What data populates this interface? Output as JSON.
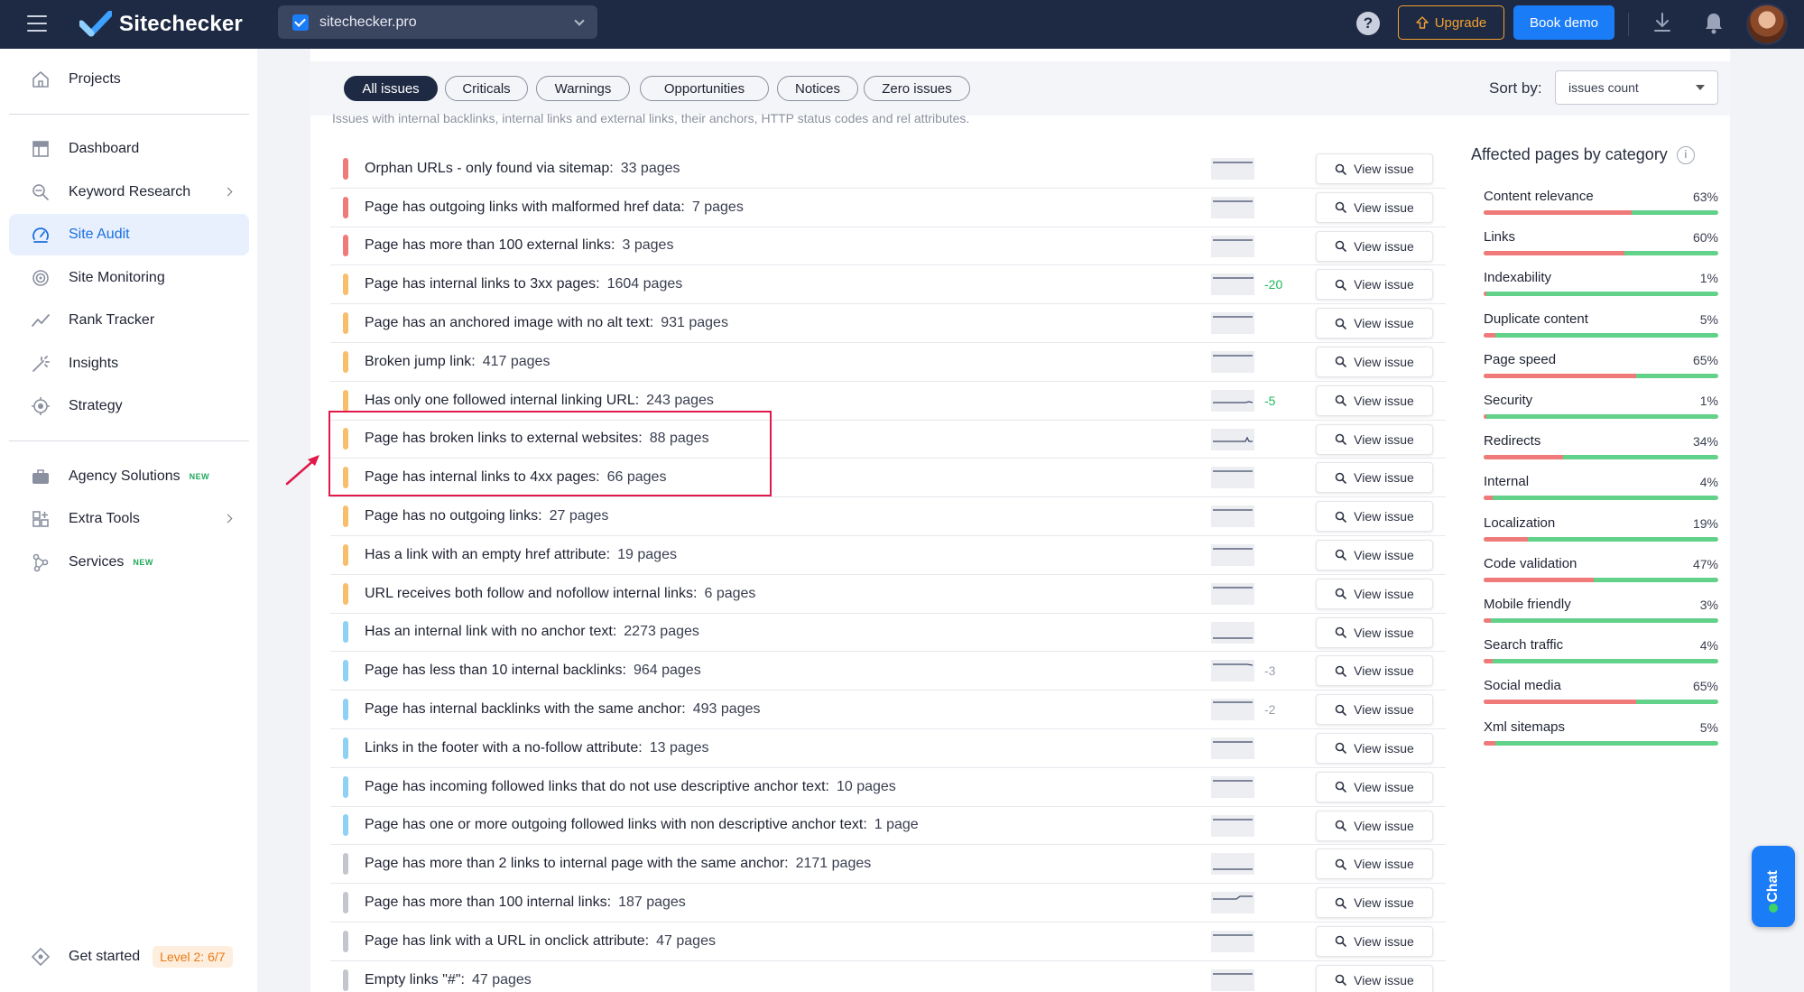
{
  "app": {
    "brand": "Sitechecker",
    "site": "sitechecker.pro",
    "help": "?",
    "upgrade_label": "Upgrade",
    "demo_label": "Book demo"
  },
  "sidebar": {
    "items": [
      {
        "label": "Projects",
        "icon": "home-icon"
      },
      {
        "label": "Dashboard",
        "icon": "dashboard-icon"
      },
      {
        "label": "Keyword Research",
        "icon": "keyword-icon"
      },
      {
        "label": "Site Audit",
        "icon": "audit-icon"
      },
      {
        "label": "Site Monitoring",
        "icon": "monitoring-icon"
      },
      {
        "label": "Rank Tracker",
        "icon": "rank-icon"
      },
      {
        "label": "Insights",
        "icon": "insights-icon"
      },
      {
        "label": "Strategy",
        "icon": "strategy-icon"
      },
      {
        "label": "Agency Solutions",
        "icon": "briefcase-icon",
        "badge": "NEW"
      },
      {
        "label": "Extra Tools",
        "icon": "tools-icon"
      },
      {
        "label": "Services",
        "icon": "services-icon",
        "badge": "NEW"
      }
    ],
    "get_started": {
      "label": "Get started",
      "level": "Level 2: 6/7"
    }
  },
  "filters": {
    "tabs": [
      "All issues",
      "Criticals",
      "Warnings",
      "Opportunities",
      "Notices",
      "Zero issues"
    ],
    "active": "All issues",
    "sort_label": "Sort by:",
    "sort_value": "issues count"
  },
  "description_cut": "Issues with internal backlinks, internal links and external links, their anchors, HTTP status codes and rel attributes.",
  "issues": [
    {
      "title": "Orphan URLs - only found via sitemap:",
      "count": "33 pages",
      "severity": "critical",
      "delta": "",
      "view": "View issue"
    },
    {
      "title": "Page has outgoing links with malformed href data:",
      "count": "7 pages",
      "severity": "critical",
      "delta": "",
      "view": "View issue"
    },
    {
      "title": "Page has more than 100 external links:",
      "count": "3 pages",
      "severity": "critical",
      "delta": "",
      "view": "View issue"
    },
    {
      "title": "Page has internal links to 3xx pages:",
      "count": "1604 pages",
      "severity": "warning",
      "delta": "-20",
      "view": "View issue"
    },
    {
      "title": "Page has an anchored image with no alt text:",
      "count": "931 pages",
      "severity": "warning",
      "delta": "",
      "view": "View issue"
    },
    {
      "title": "Broken jump link:",
      "count": "417 pages",
      "severity": "warning",
      "delta": "",
      "view": "View issue"
    },
    {
      "title": "Has only one followed internal linking URL:",
      "count": "243 pages",
      "severity": "warning",
      "delta": "-5",
      "view": "View issue"
    },
    {
      "title": "Page has broken links to external websites:",
      "count": "88 pages",
      "severity": "warning",
      "delta": "",
      "view": "View issue"
    },
    {
      "title": "Page has internal links to 4xx pages:",
      "count": "66 pages",
      "severity": "warning",
      "delta": "",
      "view": "View issue"
    },
    {
      "title": "Page has no outgoing links:",
      "count": "27 pages",
      "severity": "warning",
      "delta": "",
      "view": "View issue"
    },
    {
      "title": "Has a link with an empty href attribute:",
      "count": "19 pages",
      "severity": "warning",
      "delta": "",
      "view": "View issue"
    },
    {
      "title": "URL receives both follow and nofollow internal links:",
      "count": "6 pages",
      "severity": "warning",
      "delta": "",
      "view": "View issue"
    },
    {
      "title": "Has an internal link with no anchor text:",
      "count": "2273 pages",
      "severity": "opportunity",
      "delta": "",
      "view": "View issue"
    },
    {
      "title": "Page has less than 10 internal backlinks:",
      "count": "964 pages",
      "severity": "opportunity",
      "delta": "-3",
      "view": "View issue"
    },
    {
      "title": "Page has internal backlinks with the same anchor:",
      "count": "493 pages",
      "severity": "opportunity",
      "delta": "-2",
      "view": "View issue"
    },
    {
      "title": "Links in the footer with a no-follow attribute:",
      "count": "13 pages",
      "severity": "opportunity",
      "delta": "",
      "view": "View issue"
    },
    {
      "title": "Page has incoming followed links that do not use descriptive anchor text:",
      "count": "10 pages",
      "severity": "opportunity",
      "delta": "",
      "view": "View issue"
    },
    {
      "title": "Page has one or more outgoing followed links with non descriptive anchor text:",
      "count": "1 page",
      "severity": "opportunity",
      "delta": "",
      "view": "View issue"
    },
    {
      "title": "Page has more than 2 links to internal page with the same anchor:",
      "count": "2171 pages",
      "severity": "notice",
      "delta": "",
      "view": "View issue"
    },
    {
      "title": "Page has more than 100 internal links:",
      "count": "187 pages",
      "severity": "notice",
      "delta": "",
      "view": "View issue"
    },
    {
      "title": "Page has link with a URL in onclick attribute:",
      "count": "47 pages",
      "severity": "notice",
      "delta": "",
      "view": "View issue"
    },
    {
      "title": "Empty links \"#\":",
      "count": "47 pages",
      "severity": "notice",
      "delta": "",
      "view": "View issue"
    }
  ],
  "categories": {
    "title": "Affected pages by category",
    "items": [
      {
        "name": "Content relevance",
        "pct": "63%",
        "value": 63
      },
      {
        "name": "Links",
        "pct": "60%",
        "value": 60
      },
      {
        "name": "Indexability",
        "pct": "1%",
        "value": 1
      },
      {
        "name": "Duplicate content",
        "pct": "5%",
        "value": 5
      },
      {
        "name": "Page speed",
        "pct": "65%",
        "value": 65
      },
      {
        "name": "Security",
        "pct": "1%",
        "value": 1
      },
      {
        "name": "Redirects",
        "pct": "34%",
        "value": 34
      },
      {
        "name": "Internal",
        "pct": "4%",
        "value": 4
      },
      {
        "name": "Localization",
        "pct": "19%",
        "value": 19
      },
      {
        "name": "Code validation",
        "pct": "47%",
        "value": 47
      },
      {
        "name": "Mobile friendly",
        "pct": "3%",
        "value": 3
      },
      {
        "name": "Search traffic",
        "pct": "4%",
        "value": 4
      },
      {
        "name": "Social media",
        "pct": "65%",
        "value": 65
      },
      {
        "name": "Xml sitemaps",
        "pct": "5%",
        "value": 5
      }
    ]
  },
  "colors": {
    "critical": "#f07a7a",
    "warning": "#f7bf6b",
    "opportunity": "#8fd0f5",
    "notice": "#c3c6ce",
    "delta_positive": "#1fb85a",
    "delta_muted": "#9aa0ab"
  },
  "chat_label": "Chat"
}
